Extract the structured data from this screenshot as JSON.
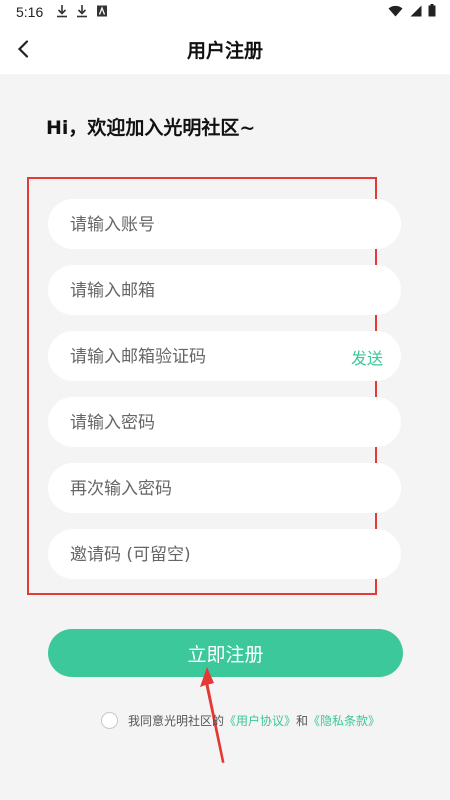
{
  "status_bar": {
    "time": "5:16",
    "left_icons": [
      "download-icon",
      "download-icon",
      "text-icon"
    ],
    "right_icons": [
      "wifi-icon",
      "signal-icon",
      "battery-icon"
    ]
  },
  "nav": {
    "title": "用户注册",
    "back_icon": "chevron-left-icon"
  },
  "greeting": "Hi，欢迎加入光明社区~",
  "form": {
    "account_placeholder": "请输入账号",
    "email_placeholder": "请输入邮箱",
    "email_code_placeholder": "请输入邮箱验证码",
    "send_label": "发送",
    "password_placeholder": "请输入密码",
    "password_confirm_placeholder": "再次输入密码",
    "invite_placeholder": "邀请码 (可留空)"
  },
  "submit_label": "立即注册",
  "agreement": {
    "prefix": "我同意光明社区的",
    "user_agreement": "《用户协议》",
    "and": "和",
    "privacy_policy": "《隐私条款》",
    "checked": false
  },
  "colors": {
    "accent": "#3dc89b",
    "highlight_box": "#e53935",
    "background": "#f4f4f4"
  }
}
